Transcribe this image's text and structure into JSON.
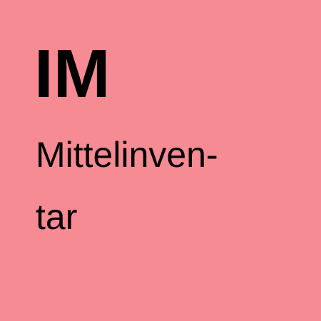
{
  "tile": {
    "abbreviation": "IM",
    "name_line_1": "Mittelinven-",
    "name_line_2": "tar"
  },
  "colors": {
    "background": "#f68b94",
    "text": "#000000"
  }
}
